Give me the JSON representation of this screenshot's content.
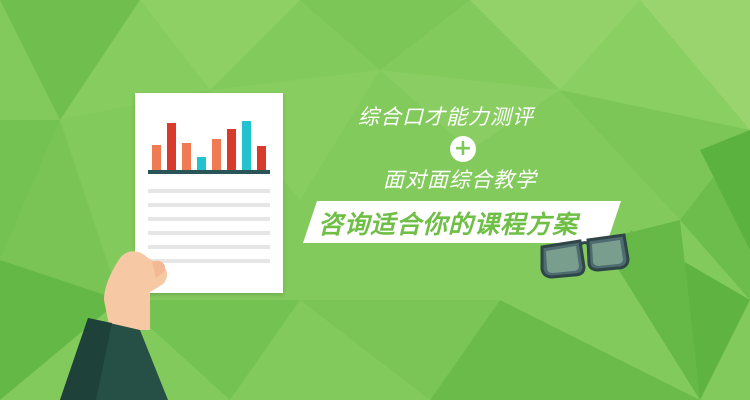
{
  "banner": {
    "line1": "综合口才能力测评",
    "plus_symbol": "+",
    "line2": "面对面综合教学",
    "ribbon_text": "咨询适合你的课程方案"
  },
  "colors": {
    "background": "#7fc95a",
    "text": "#ffffff",
    "ribbon": "#ffffff",
    "ribbon_text": "#6fbe45",
    "bar_orange": "#f07b52",
    "bar_red": "#d83a2c",
    "bar_teal": "#23c2cf",
    "chart_baseline": "#2a5558",
    "sleeve": "#264f45",
    "skin": "#f7c8a4"
  },
  "icons": {
    "document": "report-document-icon",
    "hand": "hand-icon",
    "glasses": "glasses-icon"
  }
}
